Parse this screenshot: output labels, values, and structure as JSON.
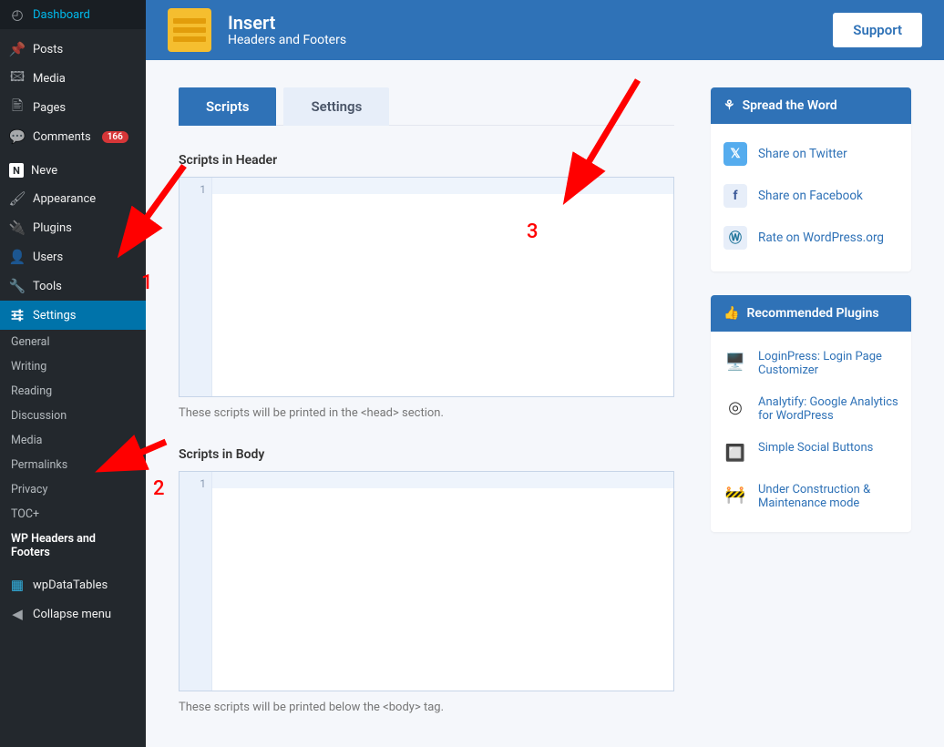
{
  "sidebar": {
    "items": [
      {
        "label": "Dashboard",
        "icon": "speedometer"
      },
      {
        "label": "Posts",
        "icon": "pin"
      },
      {
        "label": "Media",
        "icon": "media"
      },
      {
        "label": "Pages",
        "icon": "page"
      },
      {
        "label": "Comments",
        "icon": "comment",
        "badge": "166"
      },
      {
        "label": "Neve",
        "icon": "neve"
      },
      {
        "label": "Appearance",
        "icon": "brush"
      },
      {
        "label": "Plugins",
        "icon": "plug"
      },
      {
        "label": "Users",
        "icon": "user"
      },
      {
        "label": "Tools",
        "icon": "wrench"
      },
      {
        "label": "Settings",
        "icon": "sliders",
        "active": true
      },
      {
        "label": "wpDataTables",
        "icon": "table"
      },
      {
        "label": "Collapse menu",
        "icon": "collapse"
      }
    ],
    "submenu": [
      "General",
      "Writing",
      "Reading",
      "Discussion",
      "Media",
      "Permalinks",
      "Privacy",
      "TOC+",
      "WP Headers and Footers"
    ]
  },
  "topbar": {
    "title": "Insert",
    "subtitle": "Headers and Footers",
    "support": "Support"
  },
  "tabs": {
    "scripts": "Scripts",
    "settings": "Settings"
  },
  "sections": {
    "header_label": "Scripts in Header",
    "header_hint": "These scripts will be printed in the <head> section.",
    "body_label": "Scripts in Body",
    "body_hint": "These scripts will be printed below the <body> tag."
  },
  "share_card": {
    "title": "Spread the Word",
    "twitter": "Share on Twitter",
    "facebook": "Share on Facebook",
    "wp": "Rate on WordPress.org"
  },
  "plugins_card": {
    "title": "Recommended Plugins",
    "items": [
      "LoginPress: Login Page Customizer",
      "Analytify: Google Analytics for WordPress",
      "Simple Social Buttons",
      "Under Construction & Maintenance mode"
    ]
  },
  "annotations": {
    "n1": "1",
    "n2": "2",
    "n3": "3"
  }
}
